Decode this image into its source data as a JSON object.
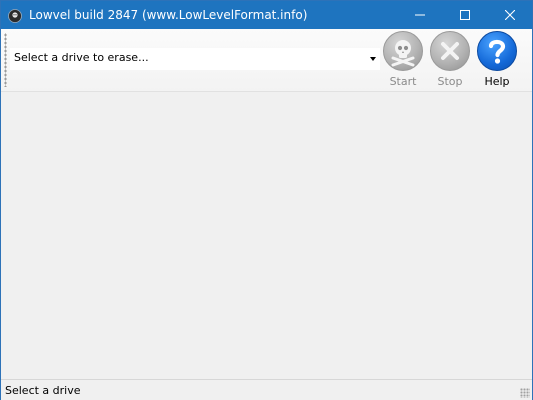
{
  "window": {
    "title": "Lowvel build 2847 (www.LowLevelFormat.info)",
    "title_bar_color": "#1e74bf"
  },
  "toolbar": {
    "drive_select": {
      "value": "Select a drive to erase..."
    },
    "buttons": [
      {
        "label": "Start",
        "icon": "skull-icon",
        "enabled": false
      },
      {
        "label": "Stop",
        "icon": "x-icon",
        "enabled": false
      },
      {
        "label": "Help",
        "icon": "question-icon",
        "enabled": true
      }
    ]
  },
  "statusbar": {
    "text": "Select a drive"
  }
}
